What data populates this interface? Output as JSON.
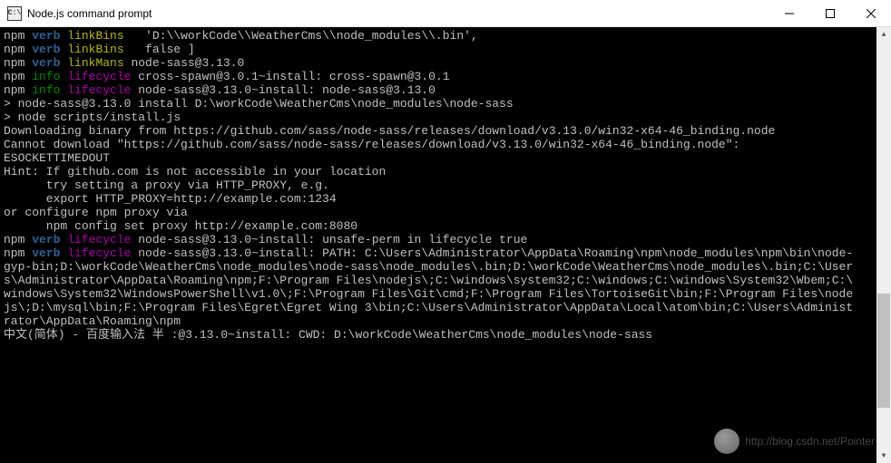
{
  "titlebar": {
    "icon_label": "C:\\",
    "title": "Node.js command prompt"
  },
  "scrollbar": {
    "thumb_top_pct": 62,
    "thumb_height_pct": 28
  },
  "colors": {
    "npm": "#c0c0c0",
    "verb": "#2a6496",
    "info": "#009000",
    "cmd_yellow": "#b8b800",
    "cmd_magenta": "#b000b0"
  },
  "watermark": {
    "text": "http://blog.csdn.net/Pointer"
  },
  "lines": [
    {
      "segs": [
        [
          "npm",
          "npm "
        ],
        [
          "verb",
          "verb "
        ],
        [
          "cy",
          "linkBins"
        ],
        [
          "white",
          "   'D:\\\\workCode\\\\WeatherCms\\\\node_modules\\\\.bin',"
        ]
      ]
    },
    {
      "segs": [
        [
          "npm",
          "npm "
        ],
        [
          "verb",
          "verb "
        ],
        [
          "cy",
          "linkBins"
        ],
        [
          "white",
          "   false ]"
        ]
      ]
    },
    {
      "segs": [
        [
          "npm",
          "npm "
        ],
        [
          "verb",
          "verb "
        ],
        [
          "cy",
          "linkMans"
        ],
        [
          "white",
          " node-sass@3.13.0"
        ]
      ]
    },
    {
      "segs": [
        [
          "npm",
          "npm "
        ],
        [
          "info",
          "info "
        ],
        [
          "mag",
          "lifecycle"
        ],
        [
          "white",
          " cross-spawn@3.0.1~install: cross-spawn@3.0.1"
        ]
      ]
    },
    {
      "segs": [
        [
          "npm",
          "npm "
        ],
        [
          "info",
          "info "
        ],
        [
          "mag",
          "lifecycle"
        ],
        [
          "white",
          " node-sass@3.13.0~install: node-sass@3.13.0"
        ]
      ]
    },
    {
      "segs": [
        [
          "white",
          ""
        ]
      ]
    },
    {
      "segs": [
        [
          "white",
          "> node-sass@3.13.0 install D:\\workCode\\WeatherCms\\node_modules\\node-sass"
        ]
      ]
    },
    {
      "segs": [
        [
          "white",
          "> node scripts/install.js"
        ]
      ]
    },
    {
      "segs": [
        [
          "white",
          ""
        ]
      ]
    },
    {
      "segs": [
        [
          "white",
          "Downloading binary from https://github.com/sass/node-sass/releases/download/v3.13.0/win32-x64-46_binding.node"
        ]
      ]
    },
    {
      "segs": [
        [
          "white",
          "Cannot download \"https://github.com/sass/node-sass/releases/download/v3.13.0/win32-x64-46_binding.node\":"
        ]
      ]
    },
    {
      "segs": [
        [
          "white",
          ""
        ]
      ]
    },
    {
      "segs": [
        [
          "white",
          "ESOCKETTIMEDOUT"
        ]
      ]
    },
    {
      "segs": [
        [
          "white",
          ""
        ]
      ]
    },
    {
      "segs": [
        [
          "white",
          "Hint: If github.com is not accessible in your location"
        ]
      ]
    },
    {
      "segs": [
        [
          "white",
          "      try setting a proxy via HTTP_PROXY, e.g."
        ]
      ]
    },
    {
      "segs": [
        [
          "white",
          ""
        ]
      ]
    },
    {
      "segs": [
        [
          "white",
          "      export HTTP_PROXY=http://example.com:1234"
        ]
      ]
    },
    {
      "segs": [
        [
          "white",
          ""
        ]
      ]
    },
    {
      "segs": [
        [
          "white",
          "or configure npm proxy via"
        ]
      ]
    },
    {
      "segs": [
        [
          "white",
          ""
        ]
      ]
    },
    {
      "segs": [
        [
          "white",
          "      npm config set proxy http://example.com:8080"
        ]
      ]
    },
    {
      "segs": [
        [
          "npm",
          "npm "
        ],
        [
          "verb",
          "verb "
        ],
        [
          "mag",
          "lifecycle"
        ],
        [
          "white",
          " node-sass@3.13.0~install: unsafe-perm in lifecycle true"
        ]
      ]
    },
    {
      "segs": [
        [
          "npm",
          "npm "
        ],
        [
          "verb",
          "verb "
        ],
        [
          "mag",
          "lifecycle"
        ],
        [
          "white",
          " node-sass@3.13.0~install: PATH: C:\\Users\\Administrator\\AppData\\Roaming\\npm\\node_modules\\npm\\bin\\node-"
        ]
      ]
    },
    {
      "segs": [
        [
          "white",
          "gyp-bin;D:\\workCode\\WeatherCms\\node_modules\\node-sass\\node_modules\\.bin;D:\\workCode\\WeatherCms\\node_modules\\.bin;C:\\User"
        ]
      ]
    },
    {
      "segs": [
        [
          "white",
          "s\\Administrator\\AppData\\Roaming\\npm;F:\\Program Files\\nodejs\\;C:\\windows\\system32;C:\\windows;C:\\windows\\System32\\Wbem;C:\\"
        ]
      ]
    },
    {
      "segs": [
        [
          "white",
          "windows\\System32\\WindowsPowerShell\\v1.0\\;F:\\Program Files\\Git\\cmd;F:\\Program Files\\TortoiseGit\\bin;F:\\Program Files\\node"
        ]
      ]
    },
    {
      "segs": [
        [
          "white",
          "js\\;D:\\mysql\\bin;F:\\Program Files\\Egret\\Egret Wing 3\\bin;C:\\Users\\Administrator\\AppData\\Local\\atom\\bin;C:\\Users\\Administ"
        ]
      ]
    },
    {
      "segs": [
        [
          "white",
          "rator\\AppData\\Roaming\\npm"
        ]
      ]
    },
    {
      "segs": [
        [
          "white",
          "中文(简体) - 百度输入法 半 :@3.13.0~install: CWD: D:\\workCode\\WeatherCms\\node_modules\\node-sass"
        ]
      ]
    }
  ]
}
